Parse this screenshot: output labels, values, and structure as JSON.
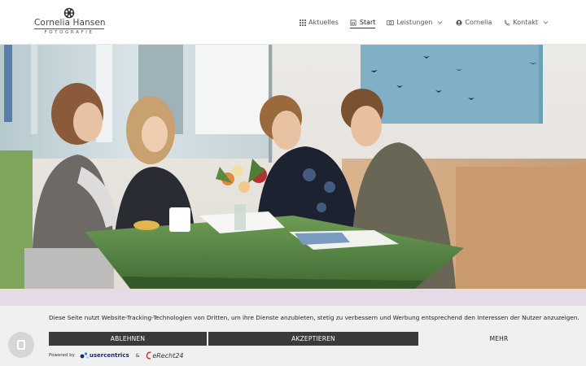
{
  "brand": {
    "name": "Cornelia Hansen",
    "tagline": "FOTOGRAFIE",
    "logo_icon": "aperture-flower-icon"
  },
  "nav": {
    "items": [
      {
        "label": "Aktuelles",
        "icon": "grid-icon",
        "has_dropdown": false,
        "active": false
      },
      {
        "label": "Start",
        "icon": "home-icon",
        "has_dropdown": false,
        "active": true
      },
      {
        "label": "Leistungen",
        "icon": "camera-icon",
        "has_dropdown": true,
        "active": false
      },
      {
        "label": "Cornelia",
        "icon": "user-icon",
        "has_dropdown": false,
        "active": false
      },
      {
        "label": "Kontakt",
        "icon": "phone-icon",
        "has_dropdown": true,
        "active": false
      }
    ]
  },
  "hero": {
    "alt": "Vier junge Leute sitzen an einem grünen Holztisch und sehen sich Unterlagen an"
  },
  "cookie": {
    "text": "Diese Seite nutzt Website-Tracking-Technologien von Dritten, um ihre Dienste anzubieten, stetig zu verbessern und Werbung entsprechend den Interessen der Nutzer anzuzeigen.",
    "decline_label": "ABLEHNEN",
    "accept_label": "AKZEPTIEREN",
    "more_label": "MEHR",
    "powered_by": "Powered by",
    "provider_1": "usercentrics",
    "amp": "&",
    "provider_2": "eRecht24"
  },
  "colors": {
    "accent_dark": "#3a3a3a",
    "banner_bg": "#f0f0f0",
    "strip_below_hero": "#e4dbe6"
  }
}
